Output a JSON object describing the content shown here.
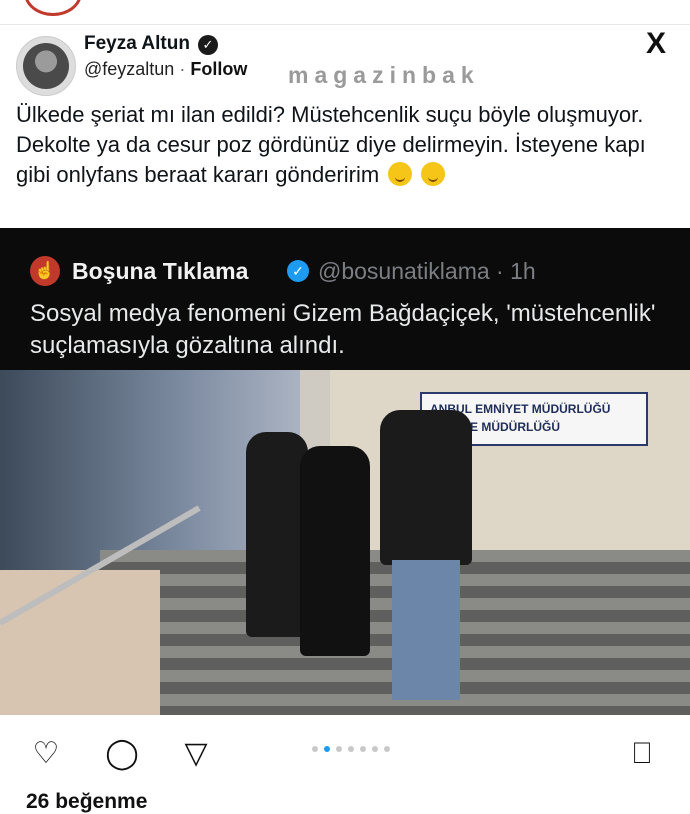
{
  "header": {
    "author_name": "Feyza Altun",
    "handle": "@feyzaltun",
    "separator": "·",
    "follow_label": "Follow",
    "watermark": "magazinbak",
    "x_logo": "X"
  },
  "tweet": {
    "text": "Ülkede şeriat mı ilan edildi? Müstehcenlik suçu böyle oluşmuyor. Dekolte ya da cesur poz gördünüz diye delirmeyin. İsteyene kapı gibi onlyfans beraat kararı gönderirim",
    "emoji_icons": [
      "kissing-face-icon",
      "winking-face-icon"
    ]
  },
  "quote": {
    "name": "Boşuna Tıklama",
    "handle_time": "@bosunatiklama · 1h",
    "text": "Sosyal medya fenomeni Gizem Bağdaçiçek, 'müstehcenlik' suçlamasıyla gözaltına alındı."
  },
  "photo": {
    "sign_line1": "ANBUL EMNİYET MÜDÜRLÜĞÜ",
    "sign_line2": "İŞ ŞUBE MÜDÜRLÜĞÜ"
  },
  "actions": {
    "likes": "26 beğenme",
    "carousel_dots": 7,
    "carousel_active": 1
  },
  "colors": {
    "quote_bg": "#0b0b0b",
    "verified_blue": "#1d9bf0"
  }
}
